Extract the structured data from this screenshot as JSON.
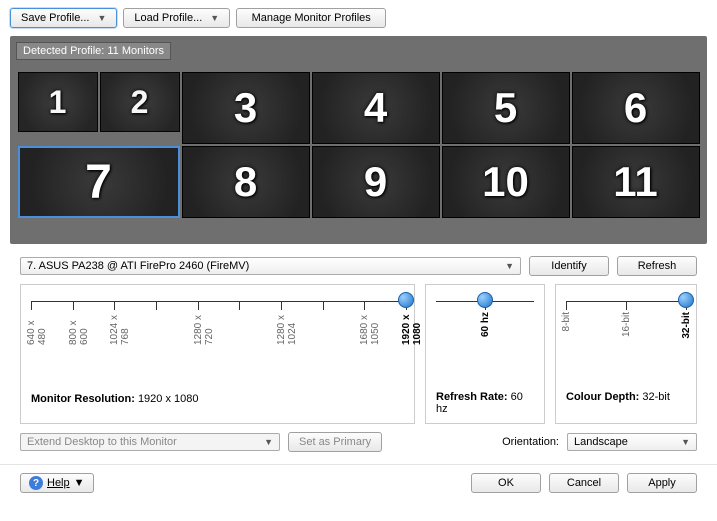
{
  "toolbar": {
    "save_profile": "Save Profile...",
    "load_profile": "Load Profile...",
    "manage_profiles": "Manage Monitor Profiles"
  },
  "detected_profile": "Detected Profile: 11 Monitors",
  "monitors": {
    "row1": [
      "1",
      "2",
      "3",
      "4",
      "5",
      "6"
    ],
    "row2": [
      "7",
      "8",
      "9",
      "10",
      "11"
    ],
    "selected": "7"
  },
  "monitor_select": "7. ASUS PA238 @ ATI FirePro 2460 (FireMV)",
  "identify": "Identify",
  "refresh": "Refresh",
  "resolution": {
    "ticks": [
      "640 x 480",
      "800 x 600",
      "1024 x 768",
      "",
      "1280 x 720",
      "",
      "1280 x 1024",
      "",
      "1680 x 1050",
      "1920 x 1080"
    ],
    "current_index": 9,
    "summary_label": "Monitor Resolution:",
    "summary_value": "1920 x 1080"
  },
  "refresh_rate": {
    "ticks": [
      "60 hz"
    ],
    "summary_label": "Refresh Rate:",
    "summary_value": "60 hz"
  },
  "colour_depth": {
    "ticks": [
      "8-bit",
      "16-bit",
      "32-bit"
    ],
    "current_index": 2,
    "summary_label": "Colour Depth:",
    "summary_value": "32-bit"
  },
  "extend_select": "Extend Desktop to this Monitor",
  "set_primary": "Set as Primary",
  "orientation_label": "Orientation:",
  "orientation_value": "Landscape",
  "help": "Help",
  "ok": "OK",
  "cancel": "Cancel",
  "apply": "Apply"
}
